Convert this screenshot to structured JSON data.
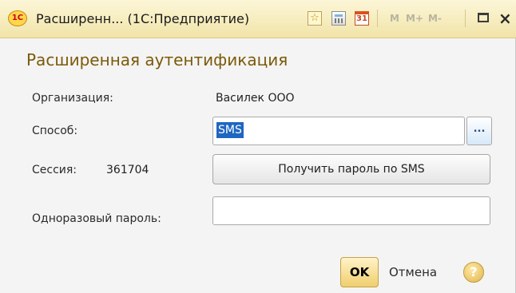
{
  "window": {
    "title": "Расширенн... (1С:Предприятие)",
    "logo_text": "1С",
    "icons": [
      "star-icon",
      "calculator-icon",
      "calendar-icon",
      "maximize-icon",
      "close-icon"
    ],
    "toolbar": {
      "calendar_day": "31",
      "m": "M",
      "m_plus": "M+",
      "m_minus": "M-",
      "close": "×"
    }
  },
  "form": {
    "heading": "Расширенная аутентификация",
    "org_label": "Организация:",
    "org_value": "Василек ООО",
    "method_label": "Способ:",
    "method_value": "SMS",
    "method_choose": "...",
    "session_label": "Сессия:",
    "session_value": "361704",
    "get_password_button": "Получить пароль по SMS",
    "otp_label": "Одноразовый пароль:",
    "otp_value": "",
    "ok_button": "OK",
    "cancel_button": "Отмена",
    "help": "?"
  },
  "colors": {
    "title_bar": "#f1e4a8",
    "heading": "#7b5a09",
    "selection": "#1f66c1",
    "ok_button": "#f0cf6d"
  }
}
